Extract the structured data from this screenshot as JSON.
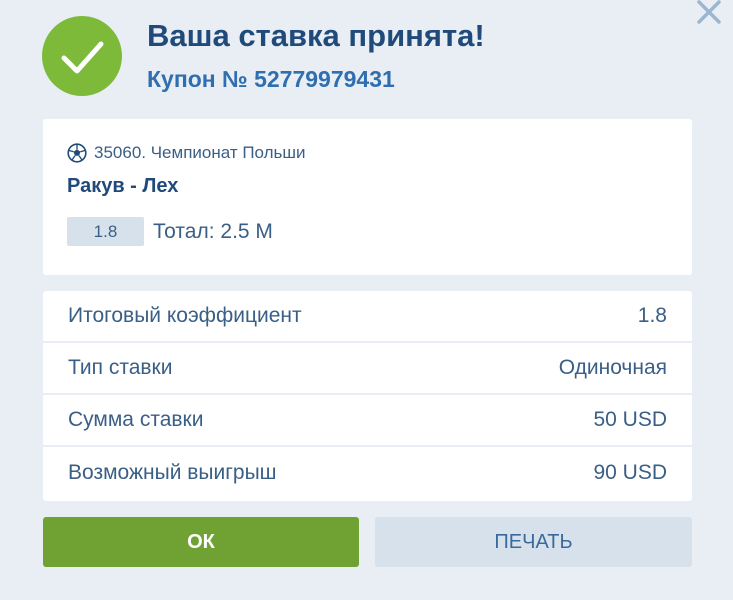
{
  "header": {
    "title": "Ваша ставка принята!",
    "coupon": "Купон № 52779979431"
  },
  "event": {
    "sport_icon": "soccer-ball-icon",
    "line": "35060. Чемпионат Польши",
    "match": "Ракув - Лех",
    "odds": "1.8",
    "bet": "Тотал: 2.5 М"
  },
  "summary": {
    "rows": [
      {
        "label": "Итоговый коэффициент",
        "value": "1.8"
      },
      {
        "label": "Тип ставки",
        "value": "Одиночная"
      },
      {
        "label": "Сумма ставки",
        "value": "50 USD"
      },
      {
        "label": "Возможный выигрыш",
        "value": "90 USD"
      }
    ]
  },
  "buttons": {
    "ok": "ОК",
    "print": "ПЕЧАТЬ"
  },
  "icons": {
    "success": "checkmark-icon",
    "close": "close-icon"
  },
  "colors": {
    "accent_green": "#7dba3a",
    "button_green": "#6fa232",
    "title_blue": "#1f4a7a",
    "link_blue": "#2f6eaf",
    "text_blue": "#3a5f86",
    "background": "#e9eef4",
    "muted_button": "#d6e1ec"
  }
}
